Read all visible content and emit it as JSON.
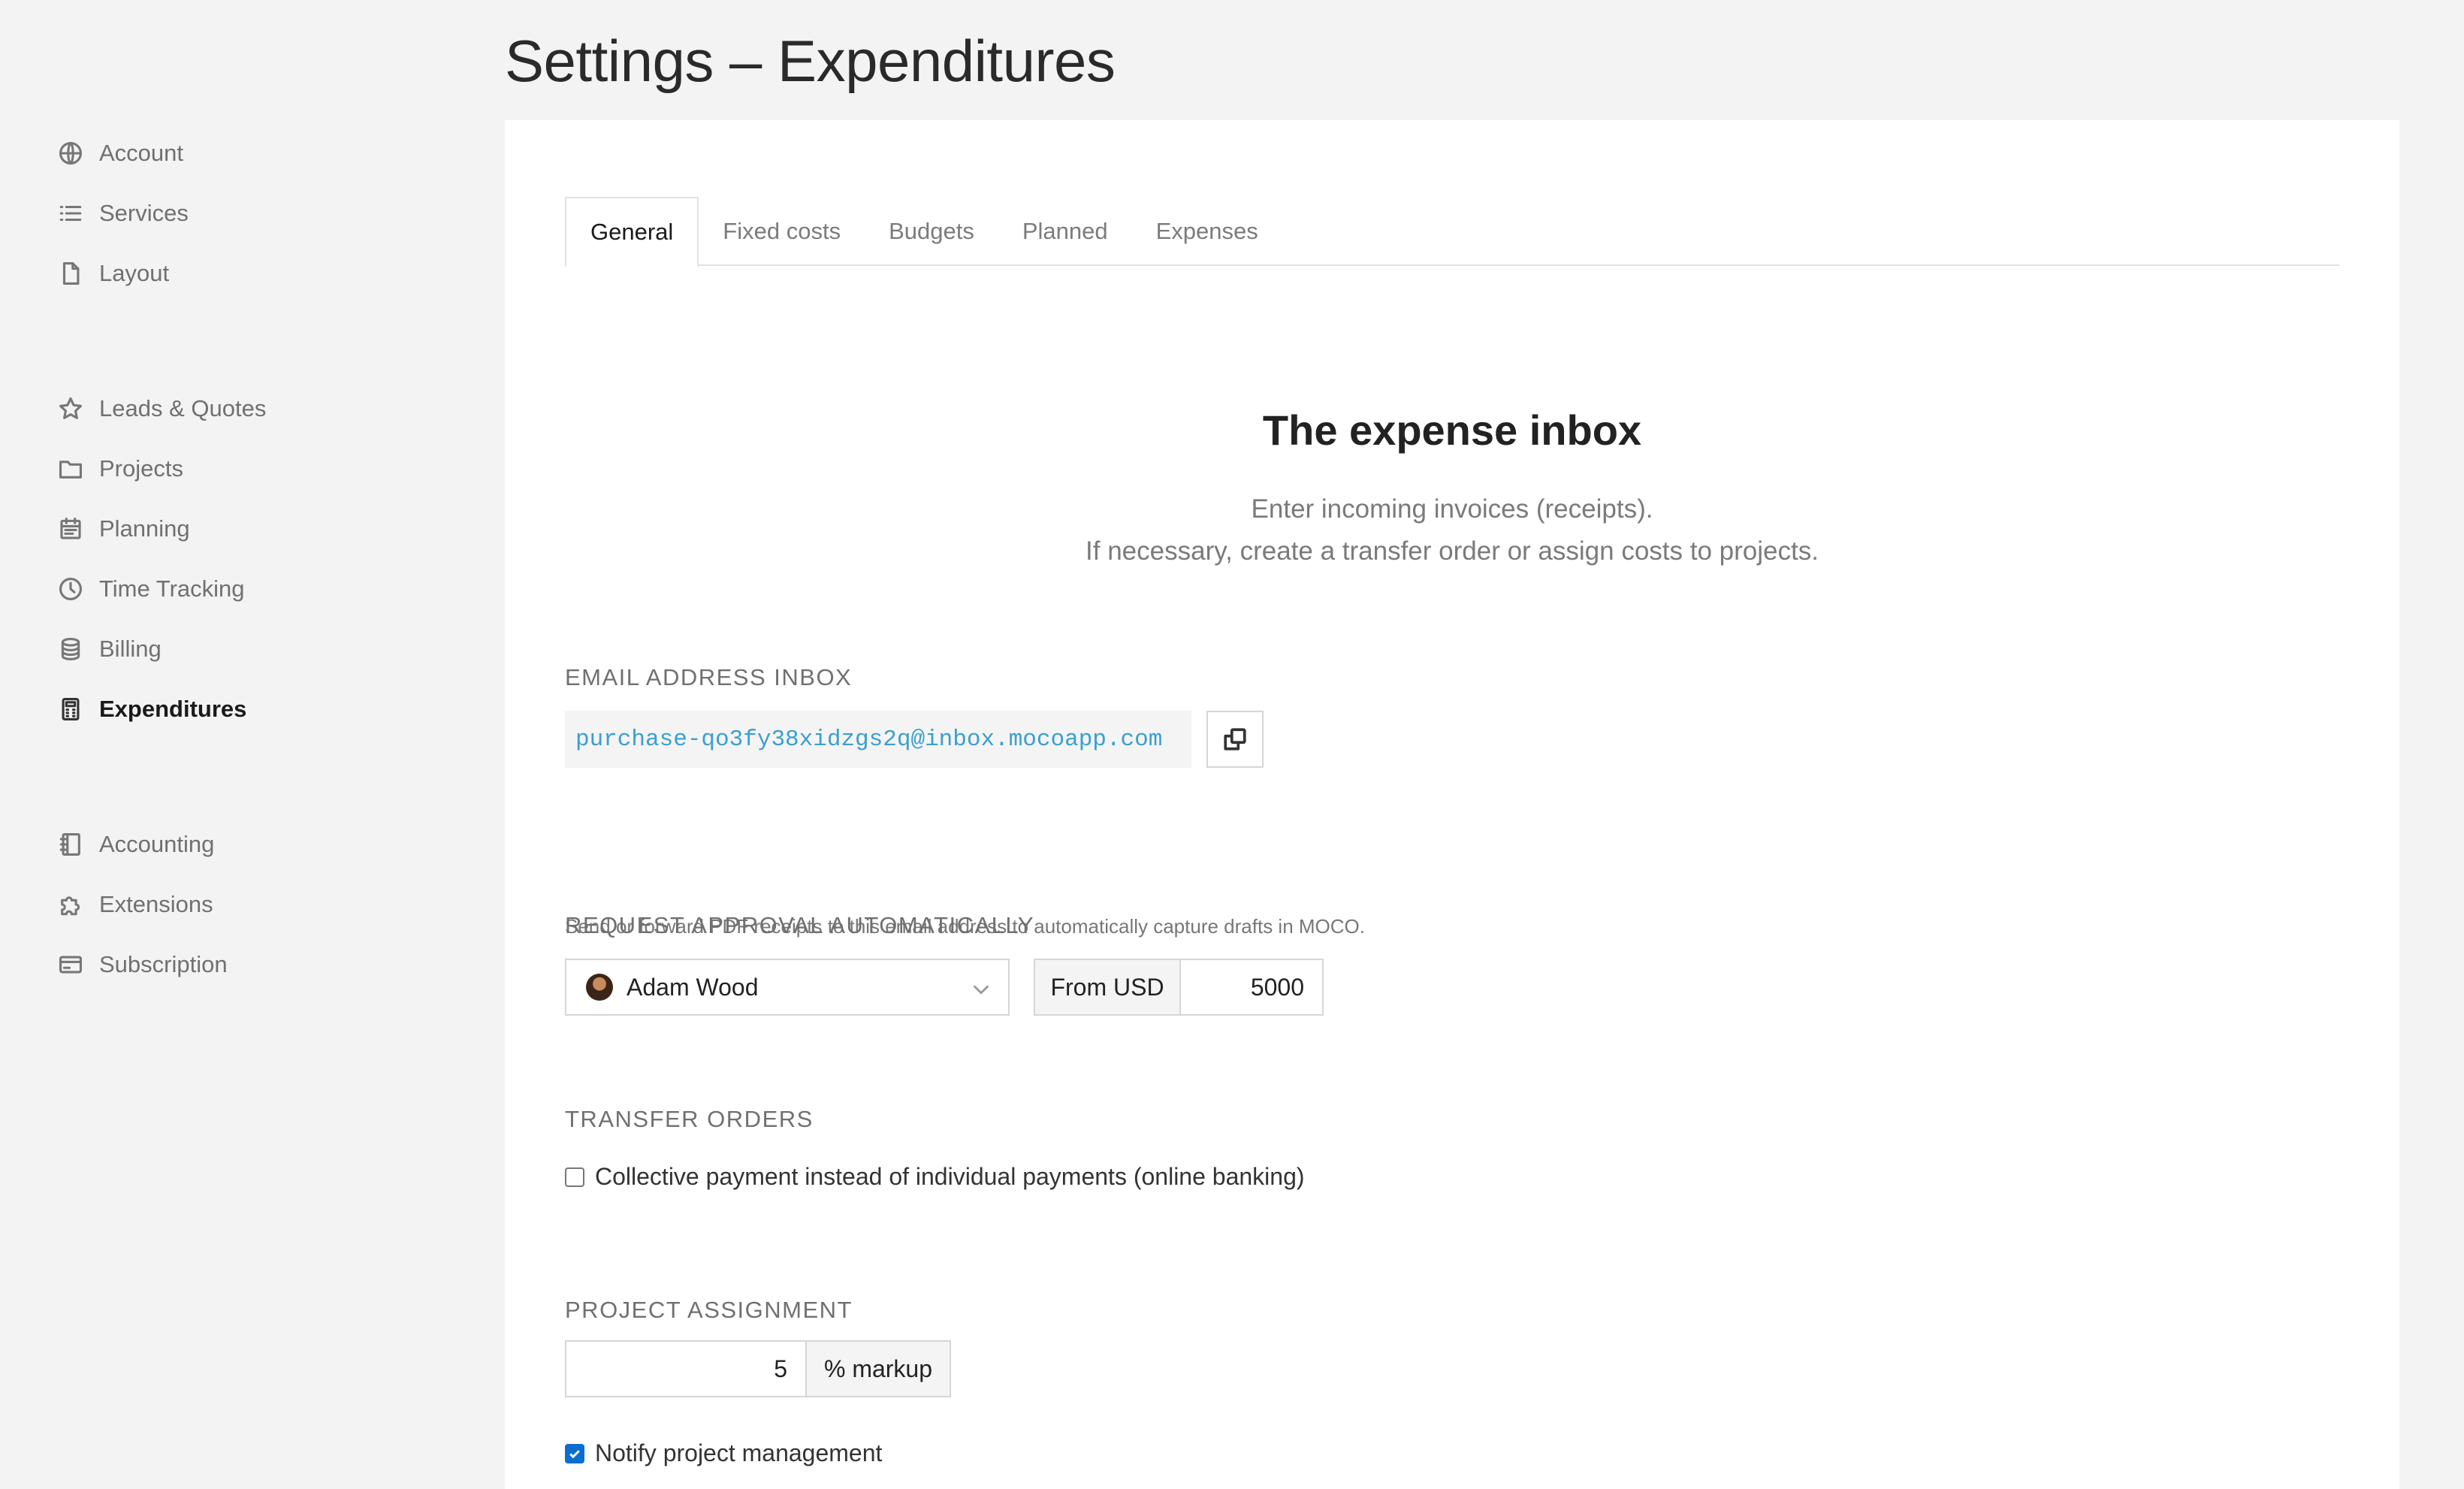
{
  "page": {
    "title": "Settings – Expenditures"
  },
  "sidebar": {
    "group1": [
      {
        "label": "Account",
        "icon": "globe-icon"
      },
      {
        "label": "Services",
        "icon": "list-icon"
      },
      {
        "label": "Layout",
        "icon": "document-icon"
      }
    ],
    "group2": [
      {
        "label": "Leads & Quotes",
        "icon": "star-icon"
      },
      {
        "label": "Projects",
        "icon": "folder-icon"
      },
      {
        "label": "Planning",
        "icon": "calendar-icon"
      },
      {
        "label": "Time Tracking",
        "icon": "clock-icon"
      },
      {
        "label": "Billing",
        "icon": "database-icon"
      },
      {
        "label": "Expenditures",
        "icon": "calculator-icon",
        "active": true
      }
    ],
    "group3": [
      {
        "label": "Accounting",
        "icon": "ledger-icon"
      },
      {
        "label": "Extensions",
        "icon": "puzzle-icon"
      },
      {
        "label": "Subscription",
        "icon": "credit-card-icon"
      }
    ]
  },
  "tabs": {
    "general": "General",
    "fixed_costs": "Fixed costs",
    "budgets": "Budgets",
    "planned": "Planned",
    "expenses": "Expenses",
    "active": "General"
  },
  "hero": {
    "title": "The expense inbox",
    "line1": "Enter incoming invoices (receipts).",
    "line2": "If necessary, create a transfer order or assign costs to projects."
  },
  "email_inbox": {
    "label": "EMAIL ADDRESS INBOX",
    "address": "purchase-qo3fy38xidzgs2q@inbox.mocoapp.com",
    "help": "Send or forward PDF receipts to this email address to automatically capture drafts in MOCO."
  },
  "approval": {
    "label": "REQUEST APPROVAL AUTOMATICALLY",
    "approver": "Adam Wood",
    "currency_addon": "From USD",
    "threshold": "5000"
  },
  "transfer_orders": {
    "label": "TRANSFER ORDERS",
    "collective_payment_label": "Collective payment instead of individual payments (online banking)",
    "collective_payment_checked": false
  },
  "project_assignment": {
    "label": "PROJECT ASSIGNMENT",
    "markup_value": "5",
    "markup_addon": "% markup",
    "notify_label": "Notify project management",
    "notify_checked": true
  },
  "colors": {
    "accent_blue": "#3a9fd0",
    "checkbox_blue": "#0a6ed1",
    "background": "#f3f3f3"
  }
}
